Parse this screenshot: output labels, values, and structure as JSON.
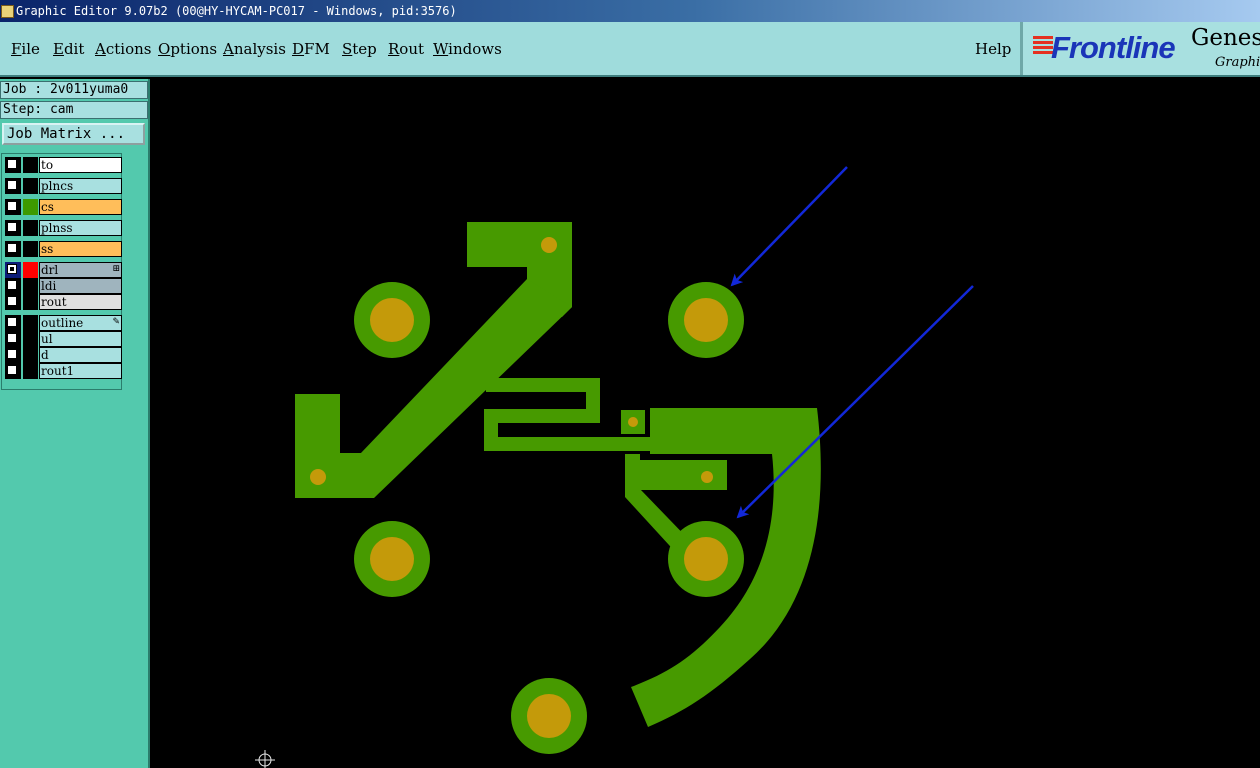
{
  "window": {
    "title": "Graphic Editor 9.07b2 (00@HY-HYCAM-PC017 - Windows, pid:3576)"
  },
  "menu": {
    "items": [
      {
        "pre": "",
        "u": "F",
        "post": "ile"
      },
      {
        "pre": "",
        "u": "E",
        "post": "dit"
      },
      {
        "pre": "",
        "u": "A",
        "post": "ctions"
      },
      {
        "pre": "",
        "u": "O",
        "post": "ptions"
      },
      {
        "pre": "",
        "u": "A",
        "post": "nalysis"
      },
      {
        "pre": "",
        "u": "D",
        "post": "FM"
      },
      {
        "pre": "",
        "u": "S",
        "post": "tep"
      },
      {
        "pre": "",
        "u": "R",
        "post": "out"
      },
      {
        "pre": "",
        "u": "W",
        "post": "indows"
      }
    ],
    "help": "Help"
  },
  "logo": {
    "brand": "Frontline",
    "product": "Genesi",
    "sub": "Graphic"
  },
  "job": {
    "label": "Job : 2v011yuma0",
    "step": "Step: cam",
    "matrix_button": "Job Matrix ..."
  },
  "layers": [
    {
      "name": "to",
      "color": "#000000",
      "bg": "#ffffff",
      "checked": false,
      "mark": ""
    },
    {
      "name": "plncs",
      "color": "#000000",
      "bg": "#a8e0e0",
      "checked": false,
      "mark": ""
    },
    {
      "name": "cs",
      "color": "#3d9a00",
      "bg": "#ffbe5a",
      "checked": false,
      "mark": ""
    },
    {
      "name": "plnss",
      "color": "#000000",
      "bg": "#a8e0e0",
      "checked": false,
      "mark": ""
    },
    {
      "name": "ss",
      "color": "#000000",
      "bg": "#ffbe5a",
      "checked": false,
      "mark": ""
    },
    {
      "name": "drl",
      "color": "#ff0000",
      "bg": "#9fb4be",
      "checked": true,
      "mark": "⊞"
    },
    {
      "name": "ldi",
      "color": "#000000",
      "bg": "#9fb4be",
      "checked": false,
      "mark": ""
    },
    {
      "name": "rout",
      "color": "#000000",
      "bg": "#e0e0e0",
      "checked": false,
      "mark": ""
    },
    {
      "name": "outline",
      "color": "#000000",
      "bg": "#a8e0e0",
      "checked": false,
      "mark": "✎"
    },
    {
      "name": "ul",
      "color": "#000000",
      "bg": "#a8e0e0",
      "checked": false,
      "mark": ""
    },
    {
      "name": "d",
      "color": "#000000",
      "bg": "#a8e0e0",
      "checked": false,
      "mark": ""
    },
    {
      "name": "rout1",
      "color": "#000000",
      "bg": "#a8e0e0",
      "checked": false,
      "mark": ""
    }
  ],
  "colors": {
    "copper": "#479a00",
    "pad_hole": "#c49a0a",
    "arrow": "#1228d8"
  }
}
